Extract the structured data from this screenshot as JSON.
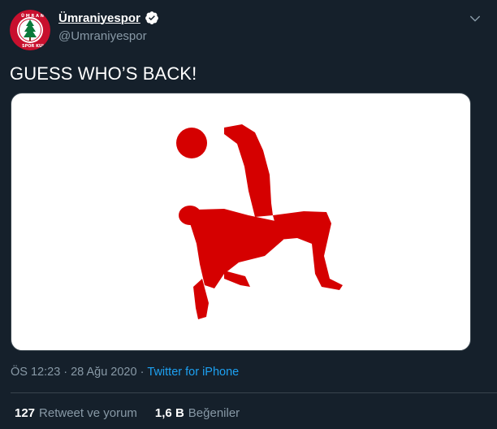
{
  "account": {
    "display_name": "Ümraniyespor",
    "handle": "@Umraniyespor",
    "verified": true,
    "avatar_icon": "umraniyespor-crest-icon",
    "avatar_colors": {
      "ring": "#c8102e",
      "inner": "#ffffff",
      "tree": "#0a7a3a"
    }
  },
  "tweet": {
    "text": "GUESS WHO’S BACK!",
    "media_icon": "bicycle-kick-silhouette-icon",
    "media_color": "#d50000"
  },
  "meta": {
    "time": "ÖS 12:23",
    "separator1": "·",
    "date": "28 Ağu 2020",
    "separator2": "·",
    "source": "Twitter for iPhone"
  },
  "stats": {
    "retweets_count": "127",
    "retweets_label": "Retweet ve yorum",
    "likes_count": "1,6 B",
    "likes_label": "Beğeniler"
  },
  "colors": {
    "background": "#15202b",
    "secondary_text": "#8899a6",
    "link": "#1da1f2",
    "divider": "#38444d"
  }
}
